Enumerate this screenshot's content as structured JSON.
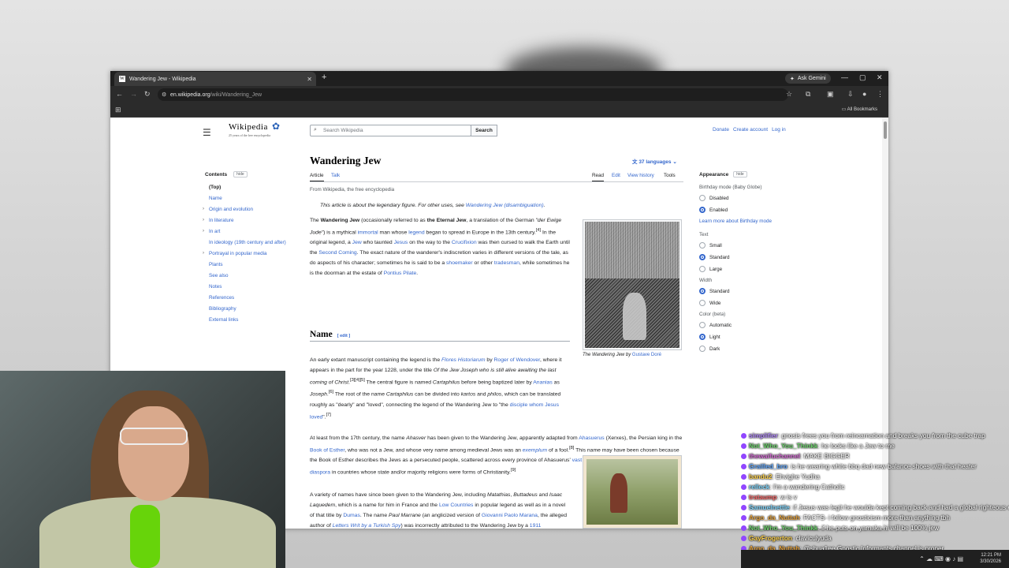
{
  "browser": {
    "tab_title": "Wandering Jew - Wikipedia",
    "tab_favicon": "W",
    "new_tab": "+",
    "ask_gemini": "Ask Gemini",
    "url_domain": "en.wikipedia.org",
    "url_path": "/wiki/Wandering_Jew",
    "all_bookmarks": "All Bookmarks"
  },
  "wiki": {
    "logo": "Wikipedia",
    "tagline": "25 years of the free encyclopedia",
    "search_placeholder": "Search Wikipedia",
    "search_button": "Search",
    "top_links": [
      "Donate",
      "Create account",
      "Log in"
    ],
    "contents_title": "Contents",
    "hide": "hide",
    "toc": [
      "(Top)",
      "Name",
      "Origin and evolution",
      "In literature",
      "In art",
      "In ideology (19th century and after)",
      "Portrayal in popular media",
      "Plants",
      "See also",
      "Notes",
      "References",
      "Bibliography",
      "External links"
    ],
    "title": "Wandering Jew",
    "languages": "37 languages",
    "tab_article": "Article",
    "tab_talk": "Talk",
    "tab_read": "Read",
    "tab_edit": "Edit",
    "tab_history": "View history",
    "tab_tools": "Tools",
    "from": "From Wikipedia, the free encyclopedia",
    "hatnote_text": "This article is about the legendary figure. For other uses, see ",
    "hatnote_link": "Wandering Jew (disambiguation)",
    "section_name": "Name",
    "section_edit": "[ edit ]",
    "caption_text": "The Wandering Jew by ",
    "caption_link": "Gustave Doré"
  },
  "appearance": {
    "title": "Appearance",
    "hide": "hide",
    "birthday_label": "Birthday mode (Baby Globe)",
    "birthday_options": [
      "Disabled",
      "Enabled"
    ],
    "learn_more": "Learn more about Birthday mode",
    "text_label": "Text",
    "text_options": [
      "Small",
      "Standard",
      "Large"
    ],
    "width_label": "Width",
    "width_options": [
      "Standard",
      "Wide"
    ],
    "color_label": "Color (beta)",
    "color_options": [
      "Automatic",
      "Light",
      "Dark"
    ]
  },
  "chat": [
    {
      "user": "simplifier",
      "msg": "gnosis frees you from reincarnation and breaks you from the cube trap",
      "color": "#b58cff"
    },
    {
      "user": "Not_Who_You_Thinkk",
      "msg": "he looks like a Jew to me",
      "color": "#6dd46d"
    },
    {
      "user": "thewaifuchannel",
      "msg": "MAKE BIGGER",
      "color": "#d66bd6"
    },
    {
      "user": "Grailled_bro",
      "msg": "is he wearing white bbq dad new balance shoes with that heater",
      "color": "#5fa8ff"
    },
    {
      "user": "bandu2",
      "msg": "Ehvighe Yudha",
      "color": "#ffd34d"
    },
    {
      "user": "relleck",
      "msg": "I'm a wandering Catholic",
      "color": "#7fd7ff"
    },
    {
      "user": "trataump",
      "msg": "w is v",
      "color": "#ff6b6b"
    },
    {
      "user": "Samuelnettle",
      "msg": "if Jesus was legit he woulda kept coming back and had a global righteous empire",
      "color": "#7fd7ff"
    },
    {
      "user": "Argo_da_Nuttah",
      "msg": "FACTS- i follow gnosticism more than anything tbh",
      "color": "#e6a23c"
    },
    {
      "user": "Not_Who_You_Thinkk",
      "msg": "if he puts on yamaka hi will be 100% jew",
      "color": "#6dd46d"
    },
    {
      "user": "GayFrogerton",
      "msg": "claviculyuda",
      "color": "#ffd34d"
    },
    {
      "user": "Argo_da_Nuttah",
      "msg": "@shua1ee Gnostic Informants channel is proper",
      "color": "#e6a23c"
    }
  ],
  "taskbar": {
    "time": "12:21 PM",
    "date": "3/30/2026"
  }
}
